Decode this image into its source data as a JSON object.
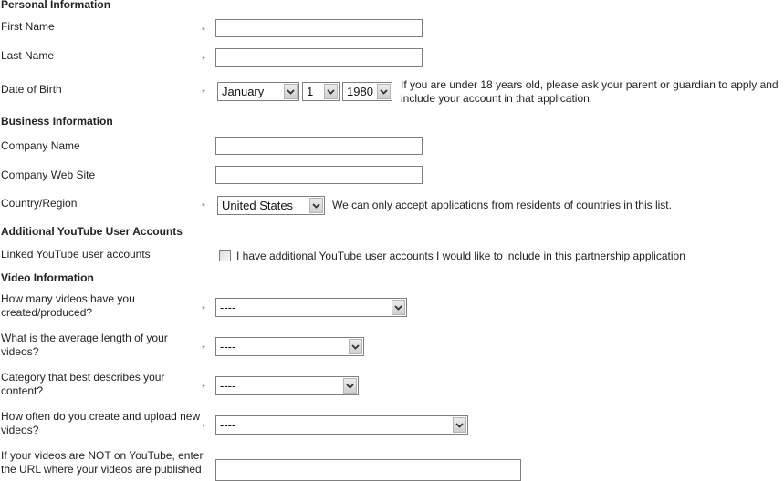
{
  "sections": {
    "personal": "Personal Information",
    "business": "Business Information",
    "additional": "Additional YouTube User Accounts",
    "video": "Video Information"
  },
  "required_marker": "*",
  "fields": {
    "first_name": {
      "label": "First Name",
      "value": ""
    },
    "last_name": {
      "label": "Last Name",
      "value": ""
    },
    "dob": {
      "label": "Date of Birth",
      "month": "January",
      "day": "1",
      "year": "1980",
      "note": "If you are under 18 years old, please ask your parent or guardian to apply and include your account in that application."
    },
    "company_name": {
      "label": "Company Name",
      "value": ""
    },
    "company_web_site": {
      "label": "Company Web Site",
      "value": ""
    },
    "country": {
      "label": "Country/Region",
      "value": "United States",
      "note": "We can only accept applications from residents of countries in this list."
    },
    "linked_accounts": {
      "label": "Linked YouTube user accounts",
      "checkbox_label": "I have additional YouTube user accounts I would like to include in this partnership application",
      "checked": false
    },
    "videos_count": {
      "label": "How many videos have you created/produced?",
      "value": "----"
    },
    "avg_length": {
      "label": "What is the average length of your videos?",
      "value": "----"
    },
    "category": {
      "label": "Category that best describes your content?",
      "value": "----"
    },
    "upload_frequency": {
      "label": "How often do you create and upload new videos?",
      "value": "----"
    },
    "external_url": {
      "label": "If your videos are NOT on YouTube, enter the URL where your videos are published",
      "value": ""
    }
  }
}
